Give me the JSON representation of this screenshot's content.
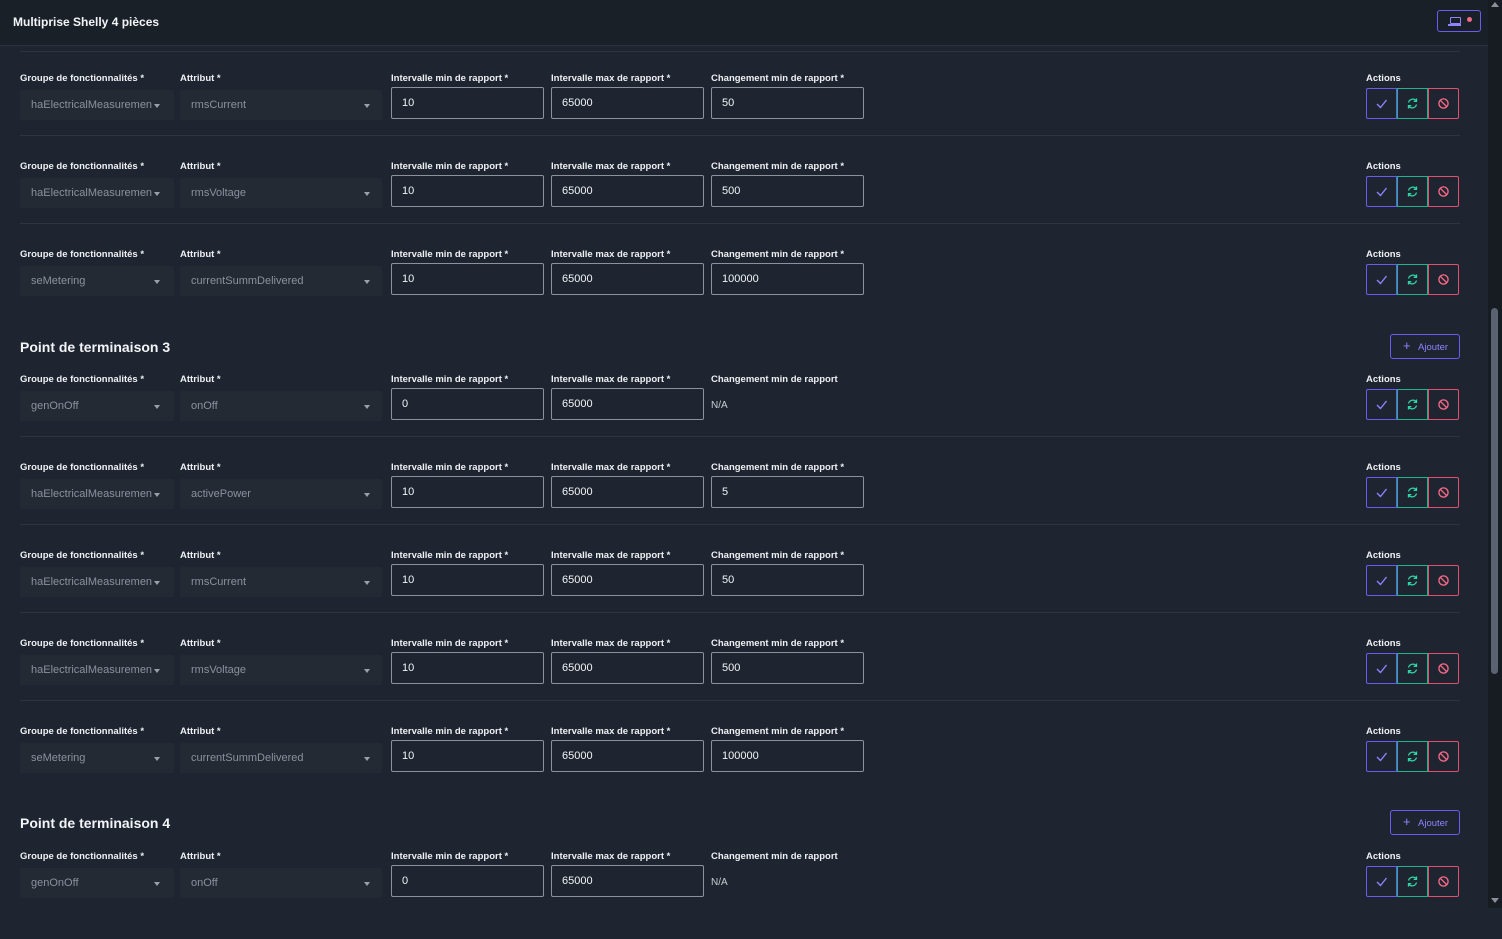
{
  "header": {
    "title": "Multiprise Shelly 4 pièces"
  },
  "labels": {
    "cluster": "Groupe de fonctionnalités *",
    "attribute": "Attribut *",
    "min_interval": "Intervalle min de rapport *",
    "max_interval": "Intervalle max de rapport *",
    "min_change": "Changement min de rapport *",
    "min_change_na": "Changement min de rapport",
    "actions": "Actions",
    "na": "N/A",
    "add": "Ajouter"
  },
  "sections": [
    {
      "title": "Point de terminaison 3"
    },
    {
      "title": "Point de terminaison 4"
    }
  ],
  "rows": [
    {
      "cluster": "haElectricalMeasuremen",
      "attribute": "rmsCurrent",
      "min": "10",
      "max": "65000",
      "change": "50"
    },
    {
      "cluster": "haElectricalMeasuremen",
      "attribute": "rmsVoltage",
      "min": "10",
      "max": "65000",
      "change": "500"
    },
    {
      "cluster": "seMetering",
      "attribute": "currentSummDelivered",
      "min": "10",
      "max": "65000",
      "change": "100000"
    },
    {
      "cluster": "genOnOff",
      "attribute": "onOff",
      "min": "0",
      "max": "65000",
      "change": null
    },
    {
      "cluster": "haElectricalMeasuremen",
      "attribute": "activePower",
      "min": "10",
      "max": "65000",
      "change": "5"
    },
    {
      "cluster": "haElectricalMeasuremen",
      "attribute": "rmsCurrent",
      "min": "10",
      "max": "65000",
      "change": "50"
    },
    {
      "cluster": "haElectricalMeasuremen",
      "attribute": "rmsVoltage",
      "min": "10",
      "max": "65000",
      "change": "500"
    },
    {
      "cluster": "seMetering",
      "attribute": "currentSummDelivered",
      "min": "10",
      "max": "65000",
      "change": "100000"
    },
    {
      "cluster": "genOnOff",
      "attribute": "onOff",
      "min": "0",
      "max": "65000",
      "change": null
    }
  ],
  "colors": {
    "background": "#1e2530",
    "accent": "#6a5cf2",
    "refresh": "#22b38c",
    "danger": "#e04f6d"
  }
}
